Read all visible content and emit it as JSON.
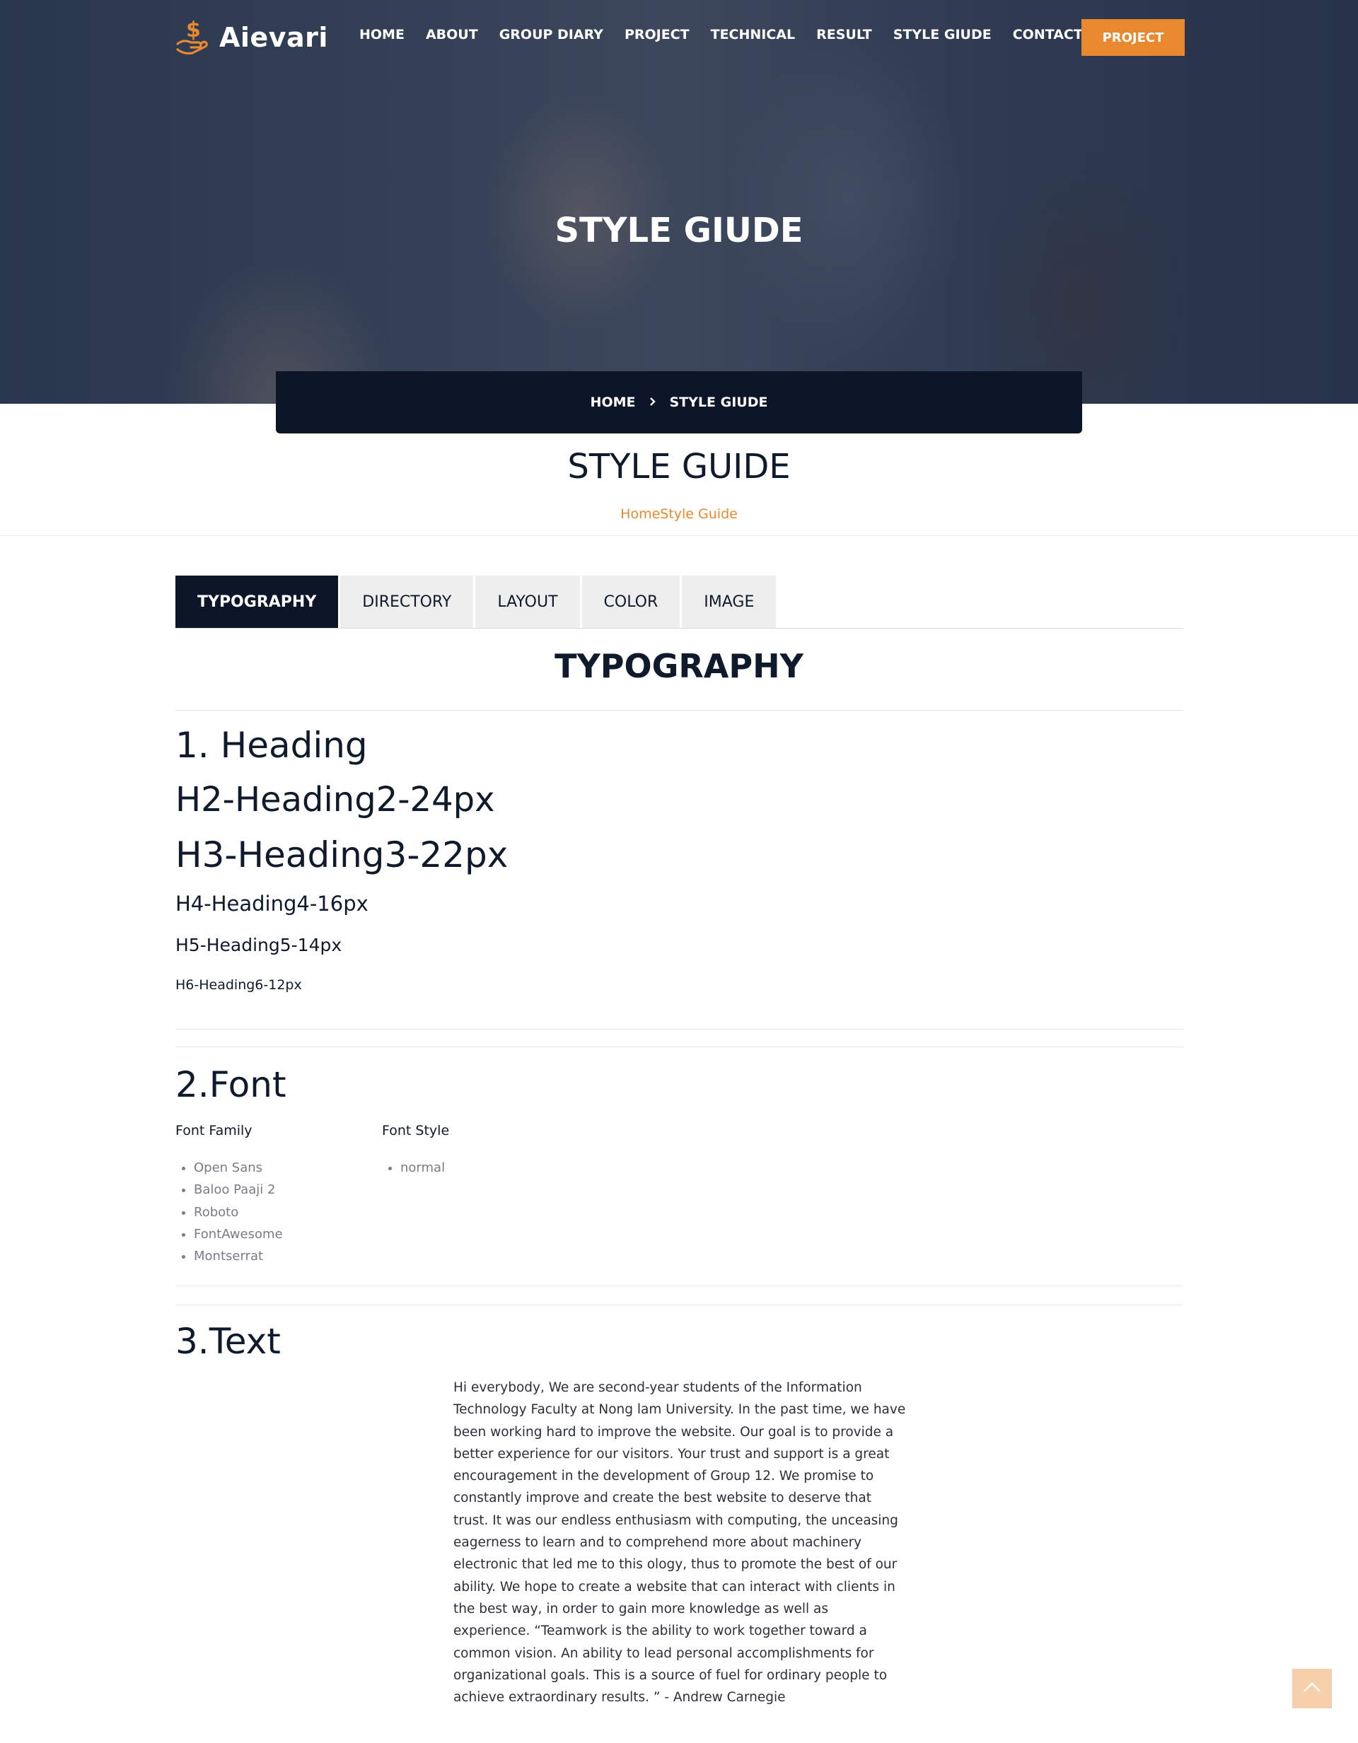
{
  "header": {
    "brand": "Aievari",
    "nav": [
      "HOME",
      "ABOUT",
      "GROUP DIARY",
      "PROJECT",
      "TECHNICAL",
      "RESULT",
      "STYLE GIUDE",
      "CONTACT"
    ],
    "cta_label": "PROJECT"
  },
  "hero": {
    "title": "STYLE GIUDE",
    "breadcrumb": {
      "home": "HOME",
      "current": "STYLE GIUDE"
    }
  },
  "page": {
    "title": "STYLE GUIDE",
    "subcrumb": "HomeStyle Guide"
  },
  "tabs": [
    "TYPOGRAPHY",
    "DIRECTORY",
    "LAYOUT",
    "COLOR",
    "IMAGE"
  ],
  "typography": {
    "title": "TYPOGRAPHY",
    "headings": {
      "h1": "1. Heading",
      "h2": "H2-Heading2-24px",
      "h3": "H3-Heading3-22px",
      "h4": "H4-Heading4-16px",
      "h5": "H5-Heading5-14px",
      "h6": "H6-Heading6-12px"
    }
  },
  "font": {
    "title": "2.Font",
    "family_label": "Font Family",
    "families": [
      "Open Sans",
      "Baloo Paaji 2",
      "Roboto",
      "FontAwesome",
      "Montserrat"
    ],
    "style_label": "Font Style",
    "styles": [
      "normal"
    ]
  },
  "text": {
    "title": "3.Text",
    "paragraph": "Hi everybody, We are second-year students of the Information Technology Faculty at Nong lam University. In the past time, we have been working hard to improve the website. Our goal is to provide a better experience for our visitors. Your trust and support is a great encouragement in the development of Group 12. We promise to constantly improve and create the best website to deserve that trust. It was our endless enthusiasm with computing, the unceasing eagerness to learn and to comprehend more about machinery electronic that led me to this ology, thus to promote the best of our ability. We hope to create a website that can interact with clients in the best way, in order to gain more knowledge as well as experience. “Teamwork is the ability to work together toward a common vision. An ability to lead personal accomplishments for organizational goals. This is a source of fuel for ordinary people to achieve extraordinary results. ” - Andrew Carnegie"
  },
  "colors": {
    "accent": "#e9892f",
    "navy": "#0c1628",
    "text": "#0f1a2c",
    "muted": "#777c85"
  },
  "icons": {
    "logo": "dollar-hand-icon",
    "breadcrumb_separator": "chevron-right-icon",
    "back_to_top": "chevron-up-icon"
  }
}
